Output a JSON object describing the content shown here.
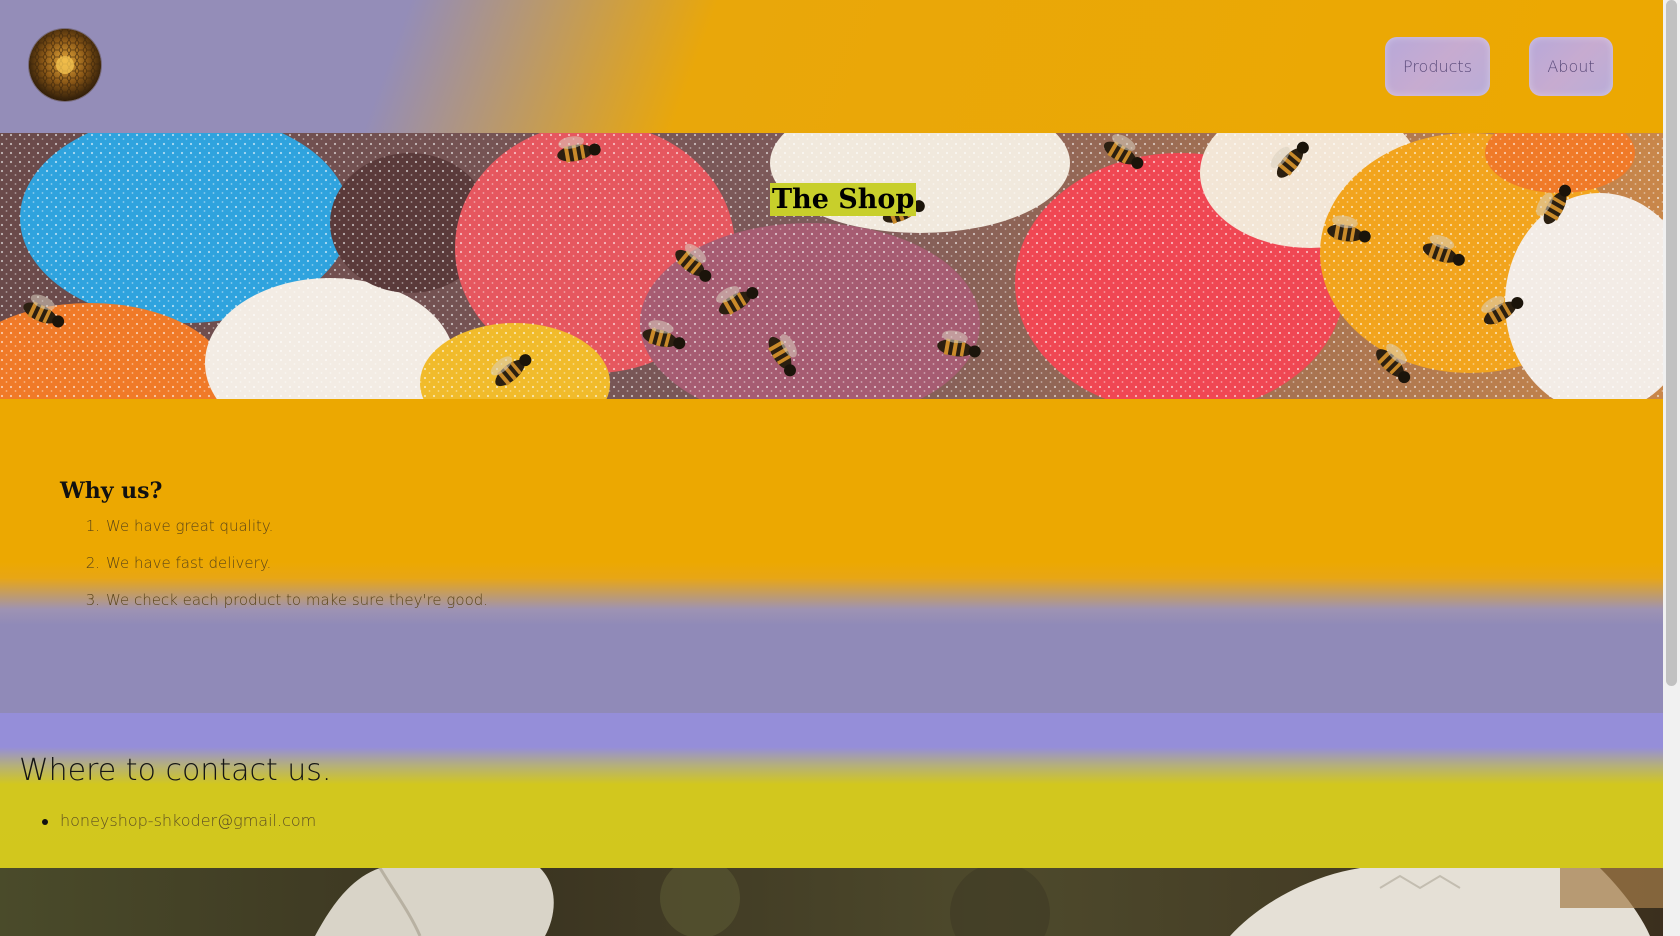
{
  "nav": {
    "logo_icon": "honeycomb-logo-icon",
    "items": [
      {
        "label": "Products"
      },
      {
        "label": "About"
      }
    ]
  },
  "hero": {
    "title": "The Shop"
  },
  "why": {
    "title": "Why us?",
    "items": [
      {
        "num": "1.",
        "text": "We have great quality."
      },
      {
        "num": "2.",
        "text": "We have fast delivery."
      },
      {
        "num": "3.",
        "text": "We check each product to make sure they're good."
      }
    ]
  },
  "contact": {
    "title": "Where to contact us.",
    "email": "honeyshop-shkoder@gmail.com"
  },
  "colors": {
    "header_start": "#948db8",
    "header_end": "#eca801",
    "section_orange": "#eca801",
    "section_lavender": "#908ab8",
    "contact_purple": "#958ed9",
    "contact_yellow": "#d2c71d",
    "title_highlight": "#c8cf2b"
  }
}
